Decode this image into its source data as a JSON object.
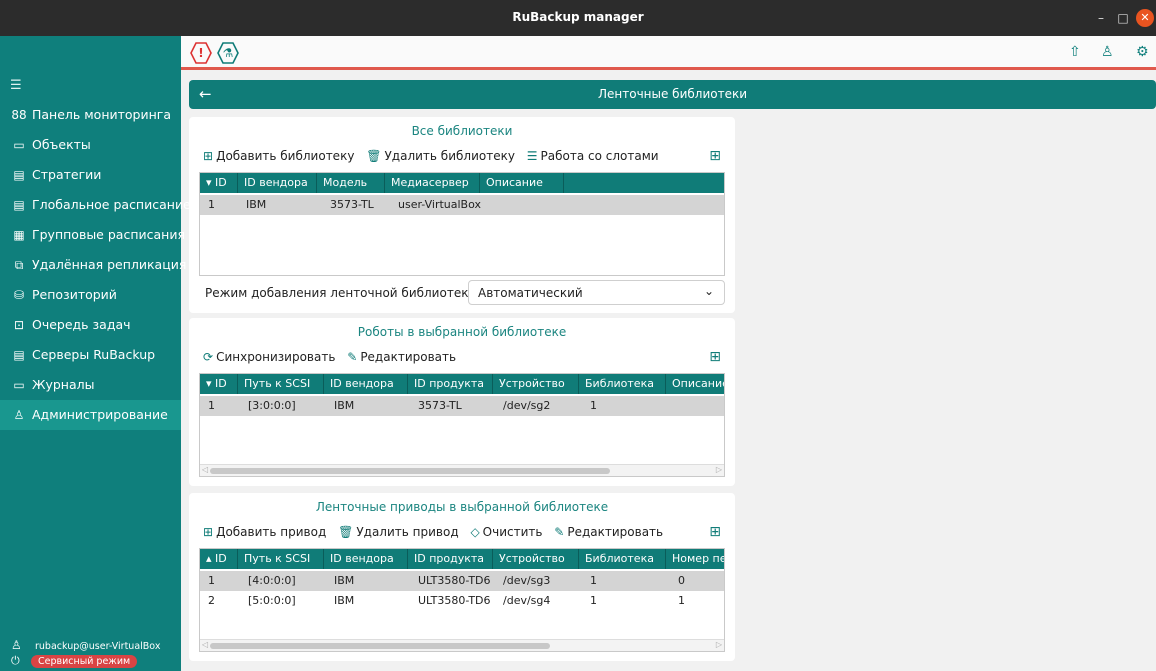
{
  "window": {
    "title": "RuBackup manager",
    "min": "–",
    "max": "□",
    "close": "✕"
  },
  "sidebar": {
    "collapse_glyph": "☰",
    "items": [
      {
        "label": "Панель мониторинга",
        "icon": "88"
      },
      {
        "label": "Объекты",
        "icon": "▭"
      },
      {
        "label": "Стратегии",
        "icon": "▤"
      },
      {
        "label": "Глобальное расписание",
        "icon": "▤"
      },
      {
        "label": "Групповые расписания",
        "icon": "▦"
      },
      {
        "label": "Удалённая репликация",
        "icon": "⧉"
      },
      {
        "label": "Репозиторий",
        "icon": "⛁"
      },
      {
        "label": "Очередь задач",
        "icon": "⊡"
      },
      {
        "label": "Серверы RuBackup",
        "icon": "▤"
      },
      {
        "label": "Журналы",
        "icon": "▭"
      },
      {
        "label": "Администрирование",
        "icon": "♙"
      }
    ],
    "user": "rubackup@user-VirtualBox",
    "service_mode": "Сервисный режим"
  },
  "topbar": {
    "alert_glyph": "!",
    "flask_glyph": "⚗",
    "upload_glyph": "⇧",
    "user_glyph": "♙",
    "settings_glyph": "⚙"
  },
  "header": {
    "title": "Ленточные библиотеки",
    "back_glyph": "←"
  },
  "libraries": {
    "title": "Все библиотеки",
    "toolbar": [
      {
        "icon": "⊞",
        "label": "Добавить библиотеку"
      },
      {
        "icon": "🗑",
        "label": "Удалить библиотеку"
      },
      {
        "icon": "☰",
        "label": "Работа со слотами"
      }
    ],
    "columns": [
      "▾ ID",
      "ID вендора",
      "Модель",
      "Медиасервер",
      "Описание"
    ],
    "rows": [
      [
        "1",
        "IBM",
        "3573-TL",
        "user-VirtualBox",
        ""
      ]
    ],
    "mode_label": "Режим добавления ленточной библиотеки:",
    "mode_value": "Автоматический",
    "mode_chevron": "⌄"
  },
  "robots": {
    "title": "Роботы в выбранной библиотеке",
    "toolbar": [
      {
        "icon": "⟳",
        "label": "Синхронизировать"
      },
      {
        "icon": "✎",
        "label": "Редактировать"
      }
    ],
    "columns": [
      "▾ ID",
      "Путь к SCSI",
      "ID вендора",
      "ID продукта",
      "Устройство",
      "Библиотека",
      "Описание"
    ],
    "rows": [
      [
        "1",
        "[3:0:0:0]",
        "IBM",
        "3573-TL",
        "/dev/sg2",
        "1",
        ""
      ]
    ]
  },
  "drives": {
    "title": "Ленточные приводы в выбранной библиотеке",
    "toolbar": [
      {
        "icon": "⊞",
        "label": "Добавить привод"
      },
      {
        "icon": "🗑",
        "label": "Удалить привод"
      },
      {
        "icon": "◇",
        "label": "Очистить"
      },
      {
        "icon": "✎",
        "label": "Редактировать"
      }
    ],
    "columns": [
      "▴ ID",
      "Путь к SCSI",
      "ID вендора",
      "ID продукта",
      "Устройство",
      "Библиотека",
      "Номер пе"
    ],
    "rows": [
      [
        "1",
        "[4:0:0:0]",
        "IBM",
        "ULT3580-TD6",
        "/dev/sg3",
        "1",
        "0"
      ],
      [
        "2",
        "[5:0:0:0]",
        "IBM",
        "ULT3580-TD6",
        "/dev/sg4",
        "1",
        "1"
      ]
    ]
  },
  "grid_glyph": "⊞",
  "scroll_left": "◁",
  "scroll_right": "▷",
  "colors": {
    "sidebar": "#0f7f7c",
    "header": "#107c78",
    "accent_line": "#e0594d",
    "badge": "#d94444"
  }
}
